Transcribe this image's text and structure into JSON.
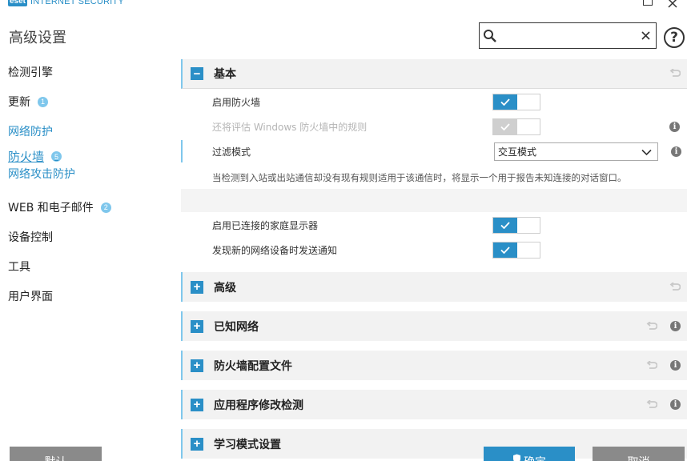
{
  "app": {
    "logo": "eset",
    "product": "INTERNET SECURITY"
  },
  "header": {
    "title": "高级设置",
    "search_placeholder": "",
    "help": "?"
  },
  "sidebar": {
    "items": [
      {
        "label": "检测引擎",
        "badge": ""
      },
      {
        "label": "更新",
        "badge": "1"
      },
      {
        "label": "网络防护",
        "badge": ""
      },
      {
        "label": "防火墙",
        "badge": "5"
      },
      {
        "label": "网络攻击防护",
        "badge": ""
      },
      {
        "label": "WEB 和电子邮件",
        "badge": "2"
      },
      {
        "label": "设备控制",
        "badge": ""
      },
      {
        "label": "工具",
        "badge": ""
      },
      {
        "label": "用户界面",
        "badge": ""
      }
    ]
  },
  "content": {
    "basic": {
      "title": "基本",
      "rows": {
        "enable_firewall": {
          "label": "启用防火墙",
          "on": true
        },
        "eval_windows_rules": {
          "label": "还将评估 Windows 防火墙中的规则",
          "on": true,
          "disabled": true
        },
        "filter_mode": {
          "label": "过滤模式",
          "value": "交互模式"
        },
        "home_monitor": {
          "label": "启用已连接的家庭显示器",
          "on": true
        },
        "new_device_notify": {
          "label": "发现新的网络设备时发送通知",
          "on": true
        }
      },
      "description": "当检测到入站或出站通信却没有现有规则适用于该通信时，将显示一个用于报告未知连接的对话窗口。"
    },
    "sections": [
      {
        "title": "高级",
        "info": false
      },
      {
        "title": "已知网络",
        "info": true
      },
      {
        "title": "防火墙配置文件",
        "info": true
      },
      {
        "title": "应用程序修改检测",
        "info": true
      },
      {
        "title": "学习模式设置",
        "info": true
      }
    ]
  },
  "footer": {
    "default_label": "默认",
    "ok_label": "确定",
    "cancel_label": "取消"
  },
  "colors": {
    "accent": "#2a8fc7",
    "badge": "#7fc7ec",
    "button_gray": "#8a8a8a"
  }
}
